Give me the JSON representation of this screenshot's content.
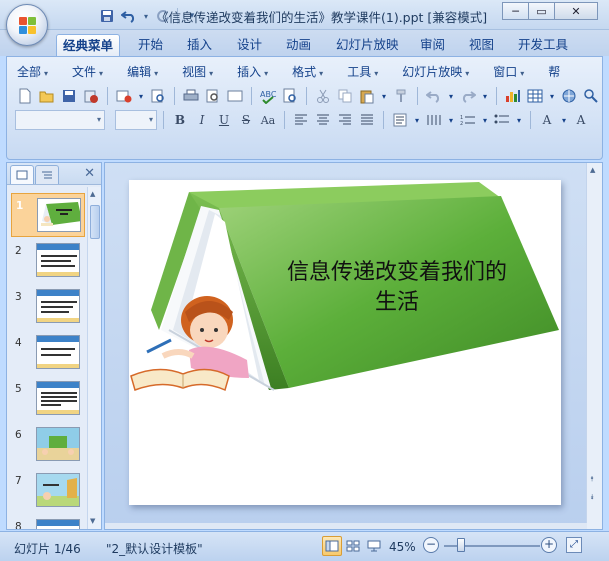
{
  "window": {
    "title": "《信息传递改变着我们的生活》教学课件(1).ppt [兼容模式]",
    "controls": {
      "minimize": "─",
      "maximize": "▭",
      "close": "✕"
    }
  },
  "quick_access": {
    "save_icon": "save-icon",
    "undo_icon": "undo-icon",
    "redo_icon": "redo-icon",
    "customize_icon": "qat-dropdown-icon"
  },
  "ribbon_tabs": [
    "经典菜单",
    "开始",
    "插入",
    "设计",
    "动画",
    "幻灯片放映",
    "审阅",
    "视图",
    "开发工具"
  ],
  "active_tab": "经典菜单",
  "classic_menus": [
    "全部",
    "文件",
    "编辑",
    "视图",
    "插入",
    "格式",
    "工具",
    "幻灯片放映",
    "窗口",
    "帮"
  ],
  "toolbar_row1_icons": [
    "new-icon",
    "open-icon",
    "save-icon",
    "permission-icon",
    "email-icon",
    "print-preview-icon",
    "print-icon",
    "preview-icon",
    "spelling-icon",
    "research-icon",
    "cut-icon",
    "copy-icon",
    "paste-icon",
    "format-painter-icon",
    "undo-icon",
    "redo-icon",
    "chart-icon",
    "table-icon",
    "hyperlink-icon",
    "zoom-icon"
  ],
  "format_buttons": {
    "bold": "B",
    "italic": "I",
    "underline": "U",
    "strikethrough": "S",
    "shadow": "Aa",
    "font_size_up": "A",
    "font_size_down": "A"
  },
  "font_name_value": "",
  "font_size_value": "",
  "slides_pane": {
    "tab_slides_icon": "slides-tab-icon",
    "tab_outline_icon": "outline-tab-icon",
    "close": "✕",
    "thumbnails": [
      {
        "number": "1"
      },
      {
        "number": "2"
      },
      {
        "number": "3"
      },
      {
        "number": "4"
      },
      {
        "number": "5"
      },
      {
        "number": "6"
      },
      {
        "number": "7"
      },
      {
        "number": "8"
      }
    ],
    "selected_slide": "1"
  },
  "slide": {
    "title": "信息传递改变着我们的生活"
  },
  "statusbar": {
    "slide_indicator": "幻灯片 1/46",
    "theme_name": "\"2_默认设计模板\"",
    "zoom": "45%"
  },
  "colors": {
    "book_green": "#4f9a34",
    "book_green_light": "#8cc864",
    "selection_orange": "#fbd39a",
    "ribbon_text": "#15428b"
  }
}
